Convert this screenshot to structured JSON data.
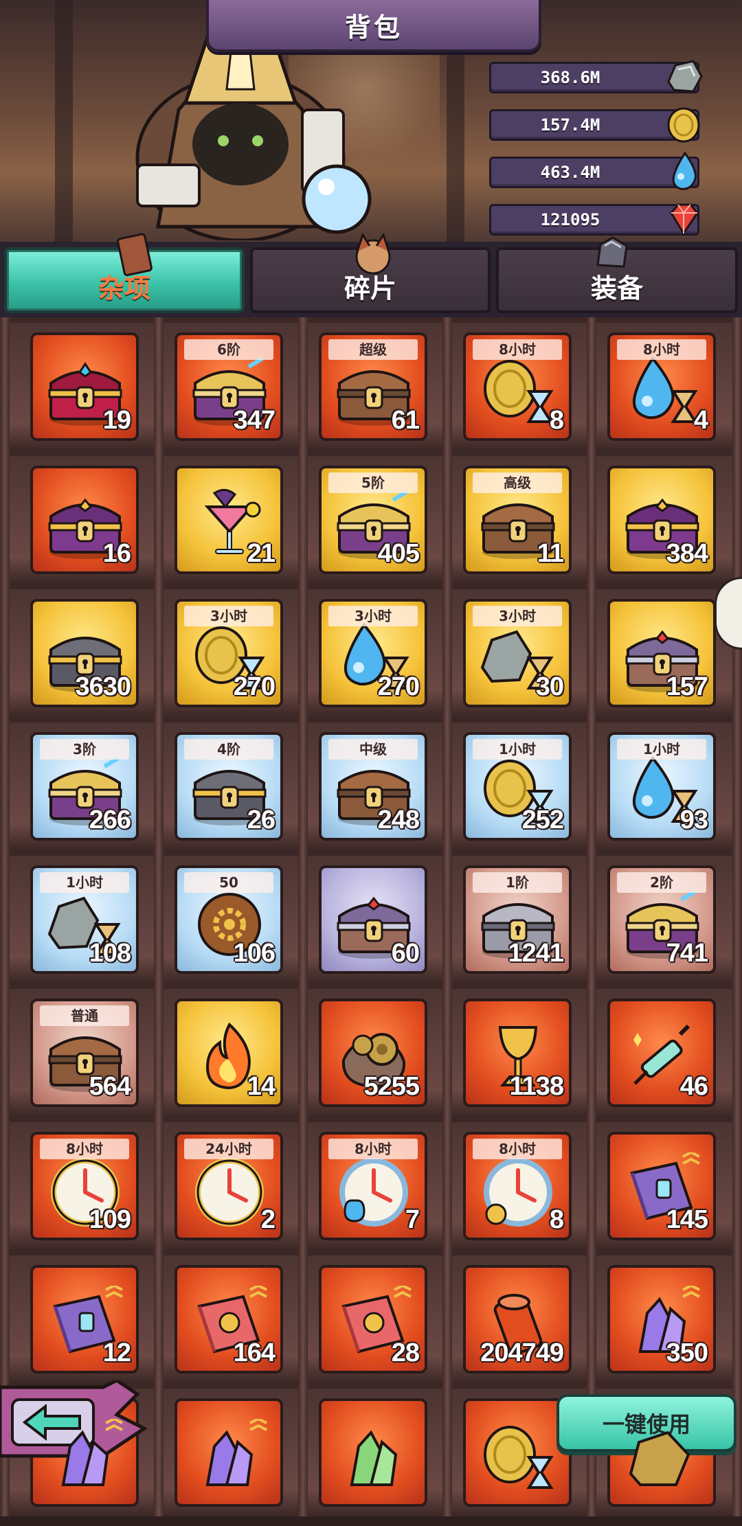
{
  "header": {
    "title": "背包"
  },
  "resources": [
    {
      "value": "368.6M",
      "icon": "ore-icon"
    },
    {
      "value": "157.4M",
      "icon": "gold-coin-icon"
    },
    {
      "value": "463.4M",
      "icon": "water-drop-icon"
    },
    {
      "value": "121095",
      "icon": "red-gem-icon"
    }
  ],
  "tabs": [
    {
      "label": "杂项",
      "active": true
    },
    {
      "label": "碎片",
      "active": false
    },
    {
      "label": "装备",
      "active": false
    }
  ],
  "items": [
    [
      {
        "bg": "red",
        "label": "",
        "qty": "19",
        "icon": "royal-chest-icon"
      },
      {
        "bg": "red",
        "label": "6阶",
        "qty": "347",
        "icon": "tier-chest-icon"
      },
      {
        "bg": "red",
        "label": "超级",
        "qty": "61",
        "icon": "wooden-chest-icon"
      },
      {
        "bg": "red",
        "label": "8小时",
        "qty": "8",
        "icon": "gold-hourglass-icon"
      },
      {
        "bg": "red",
        "label": "8小时",
        "qty": "4",
        "icon": "water-hourglass-icon"
      }
    ],
    [
      {
        "bg": "red",
        "label": "",
        "qty": "16",
        "icon": "purple-chest-icon"
      },
      {
        "bg": "gold",
        "label": "",
        "qty": "21",
        "icon": "cocktail-icon"
      },
      {
        "bg": "gold",
        "label": "5阶",
        "qty": "405",
        "icon": "tier-chest-icon"
      },
      {
        "bg": "gold",
        "label": "高级",
        "qty": "11",
        "icon": "wooden-chest-icon"
      },
      {
        "bg": "gold",
        "label": "",
        "qty": "384",
        "icon": "purple-chest-icon"
      }
    ],
    [
      {
        "bg": "gold",
        "label": "",
        "qty": "3630",
        "icon": "stone-chest-icon"
      },
      {
        "bg": "gold",
        "label": "3小时",
        "qty": "270",
        "icon": "gold-hourglass-icon"
      },
      {
        "bg": "gold",
        "label": "3小时",
        "qty": "270",
        "icon": "water-hourglass-icon"
      },
      {
        "bg": "gold",
        "label": "3小时",
        "qty": "30",
        "icon": "ore-hourglass-icon"
      },
      {
        "bg": "gold",
        "label": "",
        "qty": "157",
        "icon": "silver-chest-icon"
      }
    ],
    [
      {
        "bg": "blue",
        "label": "3阶",
        "qty": "266",
        "icon": "tier-chest-icon"
      },
      {
        "bg": "blue",
        "label": "4阶",
        "qty": "26",
        "icon": "stone-chest-icon"
      },
      {
        "bg": "blue",
        "label": "中级",
        "qty": "248",
        "icon": "wooden-chest-icon"
      },
      {
        "bg": "blue",
        "label": "1小时",
        "qty": "252",
        "icon": "gold-hourglass-icon"
      },
      {
        "bg": "blue",
        "label": "1小时",
        "qty": "93",
        "icon": "water-hourglass-icon"
      }
    ],
    [
      {
        "bg": "blue",
        "label": "1小时",
        "qty": "108",
        "icon": "ore-hourglass-icon"
      },
      {
        "bg": "blue",
        "label": "50",
        "qty": "106",
        "icon": "gear-coin-icon"
      },
      {
        "bg": "purple",
        "label": "",
        "qty": "60",
        "icon": "silver-chest-icon"
      },
      {
        "bg": "brown",
        "label": "1阶",
        "qty": "1241",
        "icon": "iron-chest-icon"
      },
      {
        "bg": "brown",
        "label": "2阶",
        "qty": "741",
        "icon": "tier-chest-icon"
      }
    ],
    [
      {
        "bg": "brown",
        "label": "普通",
        "qty": "564",
        "icon": "wooden-chest-icon"
      },
      {
        "bg": "gold",
        "label": "",
        "qty": "14",
        "icon": "fire-icon"
      },
      {
        "bg": "red",
        "label": "",
        "qty": "5255",
        "icon": "gear-bag-icon"
      },
      {
        "bg": "red",
        "label": "",
        "qty": "1138",
        "icon": "goblet-icon"
      },
      {
        "bg": "red",
        "label": "",
        "qty": "46",
        "icon": "syringe-icon"
      }
    ],
    [
      {
        "bg": "red",
        "label": "8小时",
        "qty": "109",
        "icon": "clock-icon"
      },
      {
        "bg": "red",
        "label": "24小时",
        "qty": "2",
        "icon": "clock-icon"
      },
      {
        "bg": "red",
        "label": "8小时",
        "qty": "7",
        "icon": "potion-clock-icon"
      },
      {
        "bg": "red",
        "label": "8小时",
        "qty": "8",
        "icon": "gear-clock-icon"
      },
      {
        "bg": "red",
        "label": "",
        "qty": "145",
        "icon": "purple-book-icon"
      }
    ],
    [
      {
        "bg": "red",
        "label": "",
        "qty": "12",
        "icon": "purple-book-icon"
      },
      {
        "bg": "red",
        "label": "",
        "qty": "164",
        "icon": "gear-book-icon"
      },
      {
        "bg": "red",
        "label": "",
        "qty": "28",
        "icon": "gear-book-icon"
      },
      {
        "bg": "red",
        "label": "",
        "qty": "204749",
        "icon": "scroll-icon"
      },
      {
        "bg": "red",
        "label": "",
        "qty": "350",
        "icon": "crystal-icon"
      }
    ],
    [
      {
        "bg": "red",
        "label": "",
        "qty": "",
        "icon": "crystal-icon"
      },
      {
        "bg": "red",
        "label": "",
        "qty": "",
        "icon": "crystal-icon"
      },
      {
        "bg": "red",
        "label": "",
        "qty": "",
        "icon": "green-crystal-icon"
      },
      {
        "bg": "red",
        "label": "",
        "qty": "",
        "icon": "gold-hourglass-icon"
      },
      {
        "bg": "red",
        "label": "",
        "qty": "",
        "icon": "ore-icon"
      }
    ]
  ],
  "bottom": {
    "use_all_label": "一键使用",
    "back_icon": "back-arrow-icon"
  },
  "colors": {
    "active_tab": "#3cc3a8",
    "slot_red": "#e24d1f",
    "slot_gold": "#f5c23a",
    "slot_blue": "#b8dcf5",
    "text_white": "#ffffff"
  }
}
